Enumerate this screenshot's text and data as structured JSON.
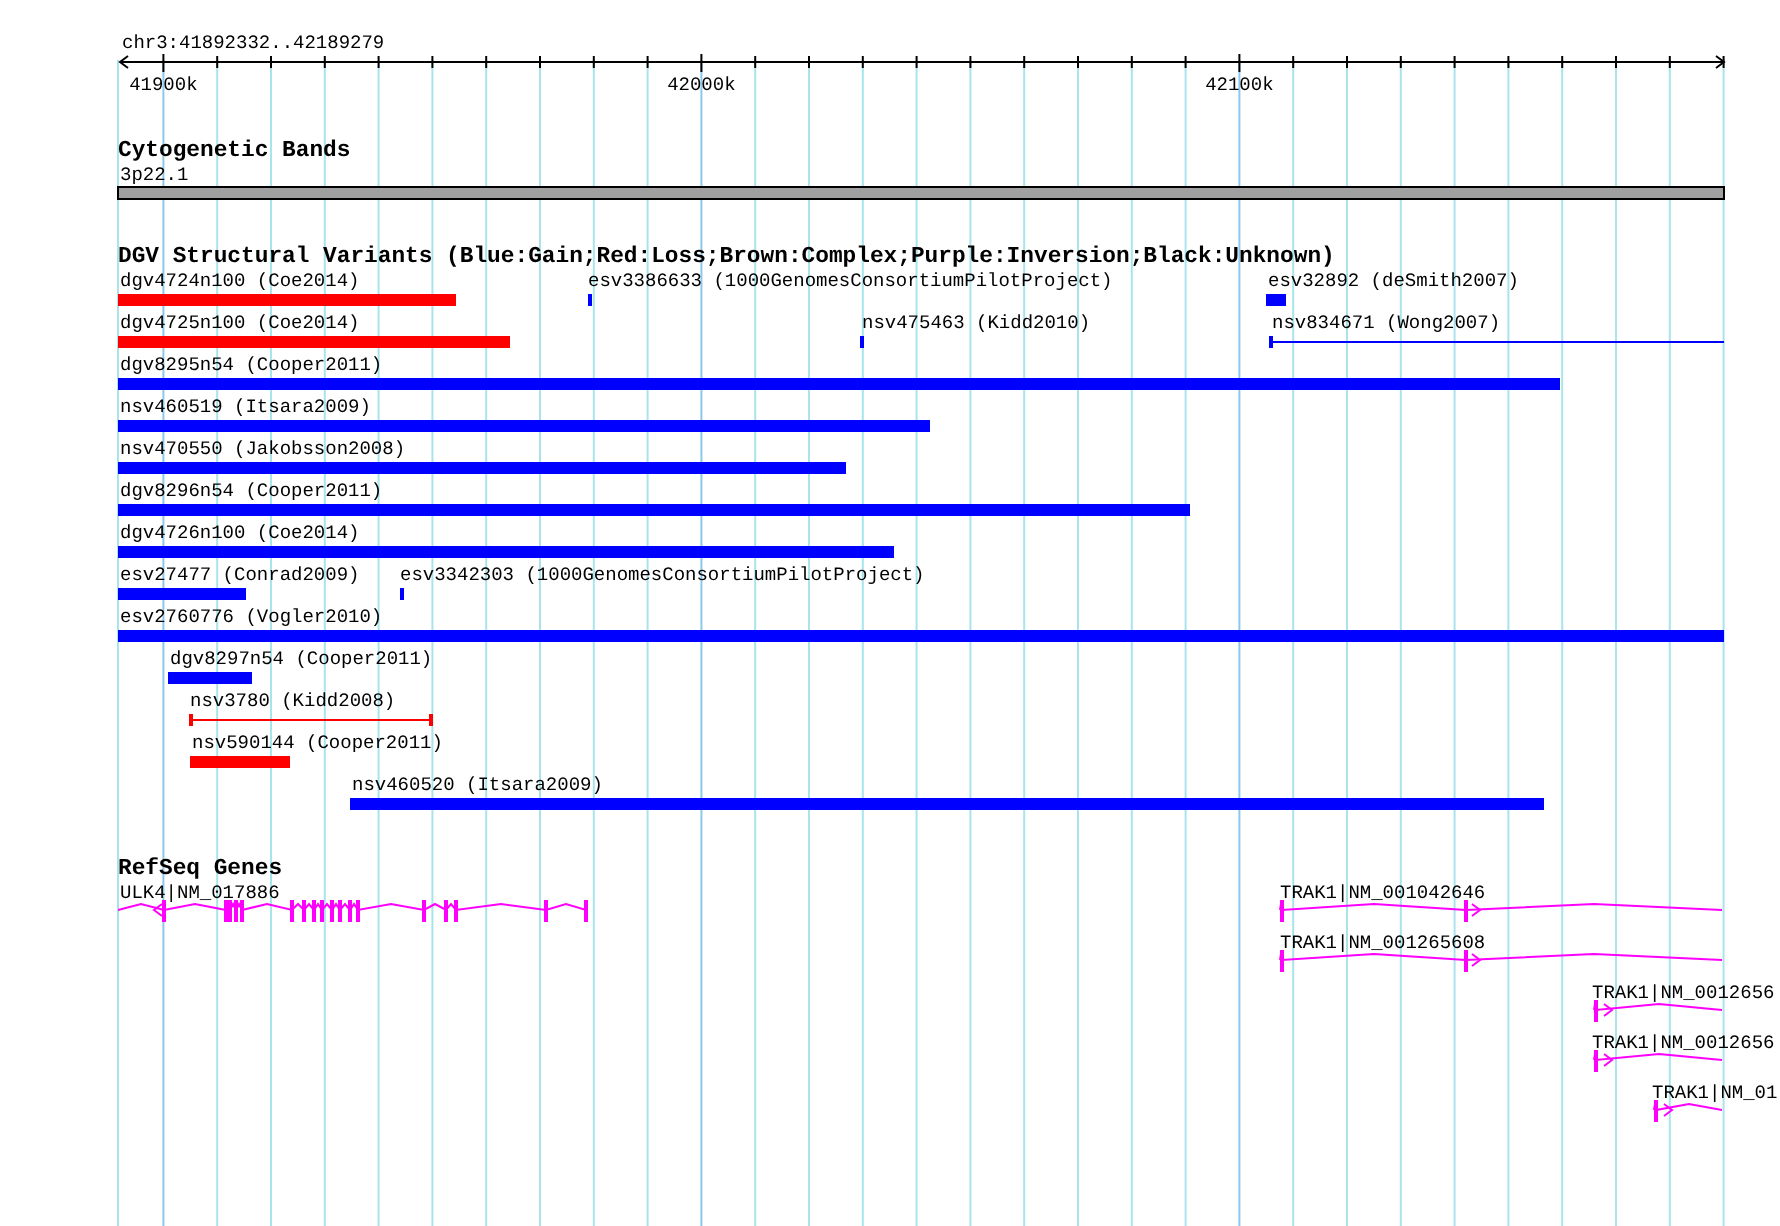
{
  "location": "chr3:41892332..42189279",
  "ruler": {
    "tick_labels": [
      "41900k",
      "42000k",
      "42100k"
    ]
  },
  "cytogenetic_bands": {
    "title": "Cytogenetic Bands",
    "band_label": "3p22.1"
  },
  "structural_variants": {
    "title": "DGV Structural Variants (Blue:Gain;Red:Loss;Brown:Complex;Purple:Inversion;Black:Unknown)",
    "features": [
      {
        "label": "dgv4724n100 (Coe2014)",
        "kind": "bar",
        "color": "#ff0000"
      },
      {
        "label": "esv3386633 (1000GenomesConsortiumPilotProject)",
        "kind": "bar",
        "color": "#0000ff"
      },
      {
        "label": "esv32892 (deSmith2007)",
        "kind": "bar",
        "color": "#0000ff"
      },
      {
        "label": "dgv4725n100 (Coe2014)",
        "kind": "bar",
        "color": "#ff0000"
      },
      {
        "label": "nsv475463 (Kidd2010)",
        "kind": "bar",
        "color": "#0000ff"
      },
      {
        "label": "nsv834671 (Wong2007)",
        "kind": "interval",
        "color": "#0000ff"
      },
      {
        "label": "dgv8295n54 (Cooper2011)",
        "kind": "bar",
        "color": "#0000ff"
      },
      {
        "label": "nsv460519 (Itsara2009)",
        "kind": "bar",
        "color": "#0000ff"
      },
      {
        "label": "nsv470550 (Jakobsson2008)",
        "kind": "bar",
        "color": "#0000ff"
      },
      {
        "label": "dgv8296n54 (Cooper2011)",
        "kind": "bar",
        "color": "#0000ff"
      },
      {
        "label": "dgv4726n100 (Coe2014)",
        "kind": "bar",
        "color": "#0000ff"
      },
      {
        "label": "esv27477 (Conrad2009)",
        "kind": "bar",
        "color": "#0000ff"
      },
      {
        "label": "esv3342303 (1000GenomesConsortiumPilotProject)",
        "kind": "bar",
        "color": "#0000ff"
      },
      {
        "label": "esv2760776 (Vogler2010)",
        "kind": "bar",
        "color": "#0000ff"
      },
      {
        "label": "dgv8297n54 (Cooper2011)",
        "kind": "bar",
        "color": "#0000ff"
      },
      {
        "label": "nsv3780 (Kidd2008)",
        "kind": "interval",
        "color": "#ff0000"
      },
      {
        "label": "nsv590144 (Cooper2011)",
        "kind": "bar",
        "color": "#ff0000"
      },
      {
        "label": "nsv460520 (Itsara2009)",
        "kind": "bar",
        "color": "#0000ff"
      }
    ]
  },
  "refseq_genes": {
    "title": "RefSeq Genes",
    "genes": [
      {
        "label": "ULK4|NM_017886"
      },
      {
        "label": "TRAK1|NM_001042646"
      },
      {
        "label": "TRAK1|NM_001265608"
      },
      {
        "label": "TRAK1|NM_0012656"
      },
      {
        "label": "TRAK1|NM_0012656"
      },
      {
        "label": "TRAK1|NM_01"
      }
    ]
  }
}
